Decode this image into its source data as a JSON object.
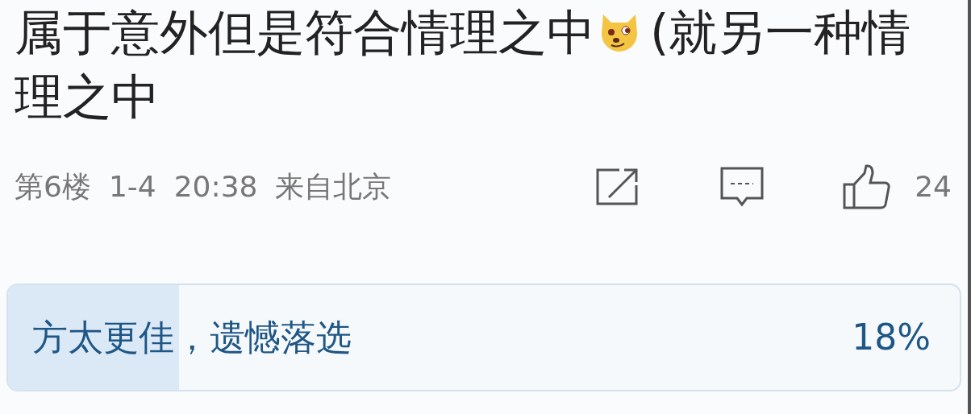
{
  "comment": {
    "text_before_emoji": "属于意外但是符合情理之中",
    "text_after_emoji": "(就另一种情",
    "text_line_2": "理之中",
    "floor": "第6楼",
    "date": "1-4",
    "time": "20:38",
    "location": "来自北京",
    "likes": "24"
  },
  "poll": {
    "options": [
      {
        "label": "方太更佳，遗憾落选",
        "percent": "18%",
        "level": 0.18
      }
    ]
  }
}
